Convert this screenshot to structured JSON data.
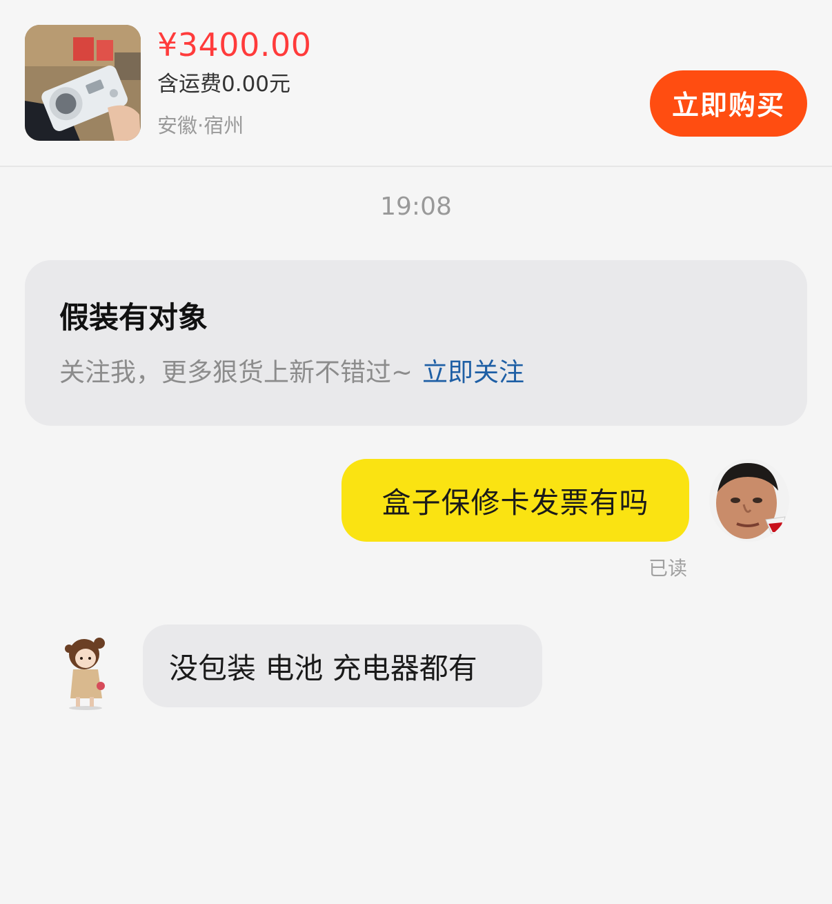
{
  "product": {
    "price": "¥3400.00",
    "shipping": "含运费0.00元",
    "location": "安徽·宿州",
    "buy_label": "立即购买"
  },
  "chat": {
    "timestamp": "19:08",
    "follow_card": {
      "title": "假装有对象",
      "description": "关注我，更多狠货上新不错过~",
      "action_label": "立即关注"
    },
    "messages": [
      {
        "from": "self",
        "text": "盒子保修卡发票有吗",
        "status": "已读"
      },
      {
        "from": "seller",
        "text": "没包装 电池 充电器都有"
      }
    ]
  },
  "colors": {
    "price": "#ff3b3b",
    "buy_button": "#ff4d11",
    "sent_bubble": "#fae312",
    "received_bubble": "#e9e9eb",
    "link": "#1e5fa5"
  }
}
